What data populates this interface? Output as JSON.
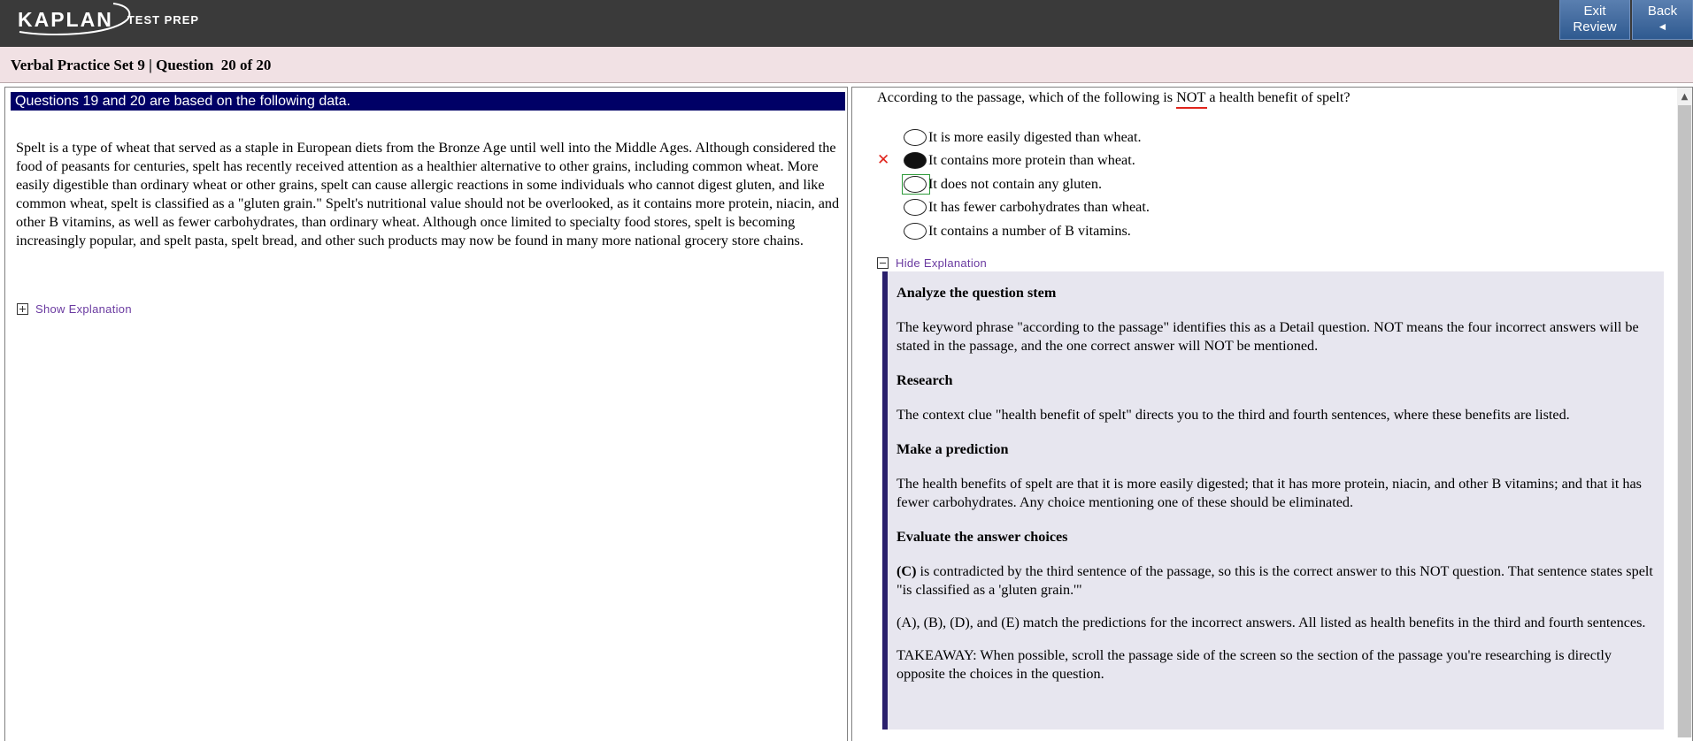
{
  "header": {
    "logo_text": "KAPLAN",
    "logo_subtext": "TEST PREP",
    "exit_review_label_1": "Exit",
    "exit_review_label_2": "Review",
    "back_label": "Back",
    "back_arrow": "◄"
  },
  "title_bar": {
    "title": "Verbal Practice Set 9 | Question  20 of 20"
  },
  "left_pane": {
    "data_header": "Questions 19 and 20 are based on the following data.",
    "passage": "Spelt is a type of wheat that served as a staple in European diets from the Bronze Age until well into the Middle Ages. Although considered the food of peasants for centuries, spelt has recently received attention as a healthier alternative to other grains, including common wheat. More easily digestible than ordinary wheat or other grains, spelt can cause allergic reactions in some individuals who cannot digest gluten, and like common wheat, spelt is classified as a \"gluten grain.\" Spelt's nutritional value should not be overlooked, as it contains more protein, niacin, and other B vitamins, as well as fewer carbohydrates, than ordinary wheat. Although once limited to specialty food stores, spelt is becoming increasingly popular, and spelt pasta, spelt bread, and other such products may now be found in many more national grocery store chains.",
    "show_explanation": "Show Explanation"
  },
  "right_pane": {
    "question_before": "According to the passage, which of the following is ",
    "question_emphasis": "NOT",
    "question_after": " a health benefit of spelt?",
    "choices": [
      {
        "label": "It is more easily digested than wheat.",
        "selected": false
      },
      {
        "label": "It contains more protein than wheat.",
        "selected": true,
        "marked_wrong": true
      },
      {
        "label": "It does not contain any gluten.",
        "selected": false,
        "correct": true
      },
      {
        "label": "It has fewer carbohydrates than wheat.",
        "selected": false
      },
      {
        "label": "It contains a number of B vitamins.",
        "selected": false
      }
    ],
    "wrong_mark": "✕",
    "hide_explanation": "Hide Explanation",
    "explanation": {
      "h1": "Analyze the question stem",
      "p1": "The keyword phrase \"according to the passage\" identifies this as a Detail question. NOT means the four incorrect answers will be stated in the passage, and the one correct answer will NOT be mentioned.",
      "h2": "Research",
      "p2": "The context clue \"health benefit of spelt\" directs you to the third and fourth sentences, where these benefits are listed.",
      "h3": "Make a prediction",
      "p3": "The health benefits of spelt are that it is more easily digested; that it has more protein, niacin, and other B vitamins; and that it has fewer carbohydrates. Any choice mentioning one of these should be eliminated.",
      "h4": "Evaluate the answer choices",
      "p4_bold": "(C)",
      "p4_rest": " is contradicted by the third sentence of the passage, so this is the correct answer to this NOT question. That sentence states spelt \"is classified as a 'gluten grain.'\"",
      "p5": "(A), (B), (D), and (E) match the predictions for the incorrect answers. All listed as health benefits in the third and fourth sentences.",
      "p6": "TAKEAWAY: When possible, scroll the passage side of the screen so the section of the passage you're researching is directly opposite the choices in the question."
    }
  },
  "colors": {
    "topbar": "#3a3a3a",
    "titlebar": "#f1e1e4",
    "data_header": "#000066",
    "explanation_bg": "#e7e6ef",
    "wrong": "#e0241c",
    "focus": "#2e9a3a",
    "link": "#6a3aa0"
  }
}
